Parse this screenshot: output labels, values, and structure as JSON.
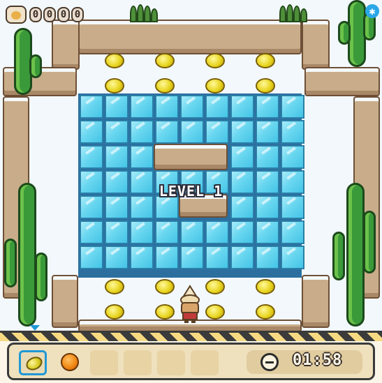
{
  "hud": {
    "score_digits": [
      "0",
      "0",
      "0",
      "0"
    ],
    "level_label": "LEVEL 1",
    "timer": "01:58",
    "settings_icon": "snowflake-icon",
    "player_icon": "cat-face-icon"
  },
  "inventory": {
    "slots": [
      {
        "item": "lemon",
        "selected": true
      },
      {
        "item": "orange",
        "selected": false
      },
      {
        "item": "",
        "selected": false
      },
      {
        "item": "",
        "selected": false
      },
      {
        "item": "",
        "selected": false
      },
      {
        "item": "",
        "selected": false
      },
      {
        "item": "",
        "selected": false
      }
    ]
  },
  "board": {
    "fruit": "lemon",
    "fruit_count": 16
  },
  "colors": {
    "ice": "#6ad7f0",
    "rock": "#c9ad8a",
    "selection": "#2098d6",
    "cactus": "#3a9a3a"
  }
}
